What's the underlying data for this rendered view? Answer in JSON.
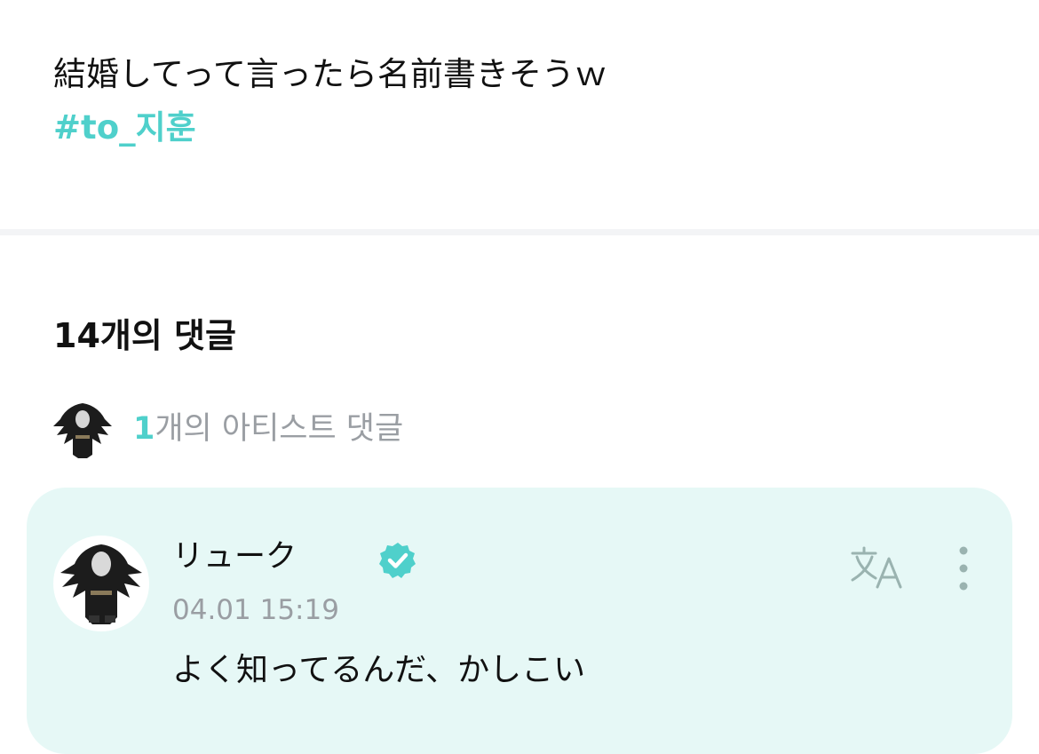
{
  "post": {
    "text": "結婚してって言ったら名前書きそうｗ",
    "hashtag": "#to_지훈"
  },
  "comments": {
    "count_label": "14개의 댓글",
    "artist_count": "1",
    "artist_label": "개의 아티스트 댓글"
  },
  "comment": {
    "author": "リューク",
    "timestamp": "04.01 15:19",
    "body": "よく知ってるんだ、かしこい"
  },
  "icons": {
    "verified": "verified-badge-icon",
    "translate": "translate-icon",
    "more": "more-vertical-icon"
  },
  "colors": {
    "accent": "#4fd0cb",
    "card_bg": "#e6f8f6",
    "muted_text": "#9a9ea3"
  }
}
